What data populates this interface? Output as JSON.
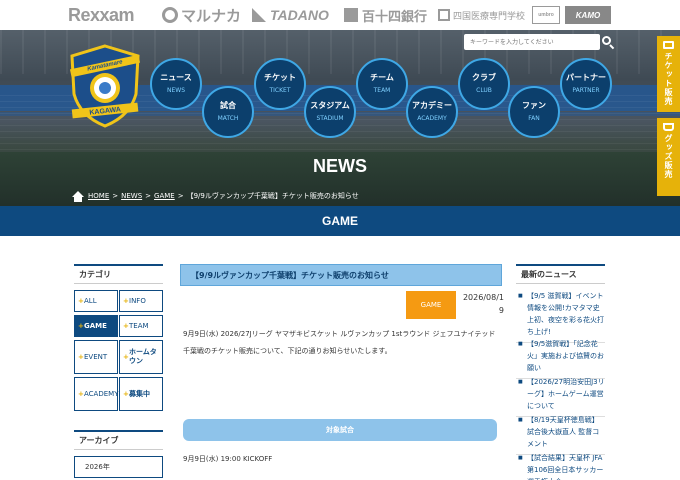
{
  "sponsors": {
    "items": [
      "Rexxam",
      "マルナカ",
      "TADANO",
      "百十四銀行",
      "四国医療専門学校",
      "umbro",
      "KAMO"
    ]
  },
  "header": {
    "search_placeholder": "キーワードを入力してください",
    "logo_text_top": "Kamatamare",
    "logo_text_bottom": "KAGAWA",
    "nav": [
      {
        "jp": "ニュース",
        "en": "NEWS"
      },
      {
        "jp": "試合",
        "en": "MATCH"
      },
      {
        "jp": "チケット",
        "en": "TICKET"
      },
      {
        "jp": "スタジアム",
        "en": "STADIUM"
      },
      {
        "jp": "チーム",
        "en": "TEAM"
      },
      {
        "jp": "アカデミー",
        "en": "ACADEMY"
      },
      {
        "jp": "クラブ",
        "en": "CLUB"
      },
      {
        "jp": "ファン",
        "en": "FAN"
      },
      {
        "jp": "パートナー",
        "en": "PARTNER"
      }
    ],
    "page_title": "NEWS"
  },
  "side_tabs": {
    "ticket": "チケット販売",
    "goods": "グッズ販売"
  },
  "breadcrumb": {
    "home": "HOME",
    "news": "NEWS",
    "game": "GAME",
    "current": "【9/9ルヴァンカップ千葉戦】チケット販売のお知らせ"
  },
  "section": {
    "title": "GAME"
  },
  "sidebar": {
    "category_title": "カテゴリ",
    "categories": [
      {
        "label": "ALL"
      },
      {
        "label": "INFO"
      },
      {
        "label": "GAME"
      },
      {
        "label": "TEAM"
      },
      {
        "label": "EVENT"
      },
      {
        "label": "ホームタウン"
      },
      {
        "label": "ACADEMY"
      },
      {
        "label": "募集中"
      }
    ],
    "archive_title": "アーカイブ",
    "archive_year": "2026年"
  },
  "article": {
    "title": "【9/9ルヴァンカップ千葉戦】チケット販売のお知らせ",
    "category": "GAME",
    "date": "2026/08/19",
    "body": "9月9日(水) 2026/27Jリーグ ヤマザキビスケット ルヴァンカップ 1stラウンド ジェフユナイテッド千葉戦のチケット販売について、下記の通りお知らせいたします。",
    "subhead": "対象試合",
    "kickoff": "9月9日(水) 19:00 KICKOFF"
  },
  "news": {
    "title": "最新のニュース",
    "items": [
      "【9/5 滋賀戦】イベント情報を公開!カマタマ史上初、夜空を彩る花火打ち上げ!",
      "【9/5滋賀戦】「記念花火」実施および協賛のお願い",
      "【2026/27明治安田J3リーグ】ホームゲーム運営について",
      "【8/19天皇杯徳島戦】試合後大嶽直人 監督コメント",
      "【試合結果】天皇杯 JFA 第106回全日本サッカー選手権大会"
    ]
  }
}
